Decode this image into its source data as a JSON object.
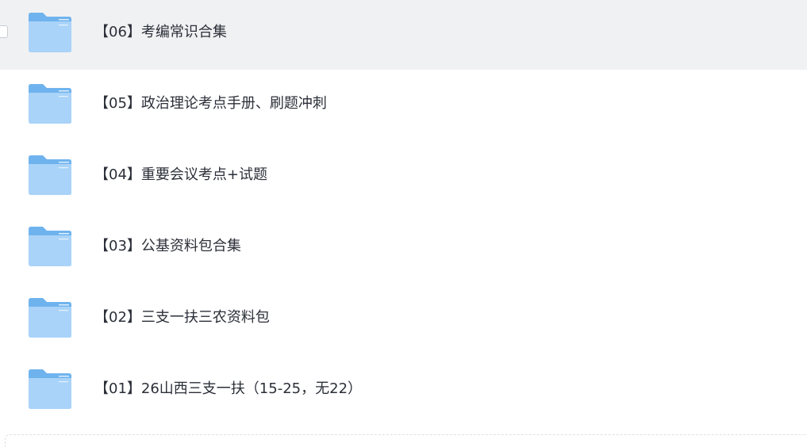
{
  "file_list": {
    "items": [
      {
        "name": "【06】考编常识合集",
        "type": "folder",
        "icon": "folder-icon",
        "selected": true
      },
      {
        "name": "【05】政治理论考点手册、刷题冲刺",
        "type": "folder",
        "icon": "folder-icon",
        "selected": false
      },
      {
        "name": "【04】重要会议考点+试题",
        "type": "folder",
        "icon": "folder-icon",
        "selected": false
      },
      {
        "name": "【03】公基资料包合集",
        "type": "folder",
        "icon": "folder-icon",
        "selected": false
      },
      {
        "name": "【02】三支一扶三农资料包",
        "type": "folder",
        "icon": "folder-icon",
        "selected": false
      },
      {
        "name": "【01】26山西三支一扶（15-25，无22）",
        "type": "folder",
        "icon": "folder-icon",
        "selected": false
      }
    ]
  },
  "colors": {
    "selected_row_bg": "#f0f1f3",
    "folder_light": "#a9d3f8",
    "folder_dark": "#6fb3ee",
    "text": "#2b2f38"
  }
}
